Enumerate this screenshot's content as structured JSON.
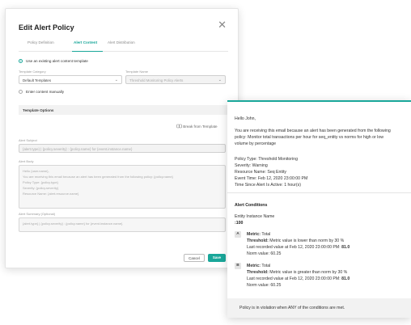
{
  "modal": {
    "title": "Edit Alert Policy",
    "close": "✕",
    "tabs": [
      {
        "label": "Policy Definition"
      },
      {
        "label": "Alert Content"
      },
      {
        "label": "Alert Distribution"
      }
    ],
    "option_existing": "Use an existing alert content template",
    "template_category_label": "Template Category",
    "template_category_value": "Default Templates",
    "template_name_label": "Template Name",
    "template_name_value": "Threshold Monitoring Policy Alerts",
    "option_manual": "Enter content manually",
    "template_options": "Template Options",
    "break_from_template": "Break from Template",
    "alert_subject_label": "Alert Subject",
    "alert_subject_value": "{alert.type} | {policy.severity} : {policy.name} for {event.instance.name}",
    "alert_body_label": "Alert Body",
    "alert_body_lines": [
      "Hello {user.name},",
      "",
      "You are receiving this email because an alert has been generated from the following policy: {policy.name}",
      "",
      "Policy Type: {policy.type}",
      "Severity: {policy.severity}",
      "Resource Name: {alert.resource.name}"
    ],
    "alert_summary_label": "Alert Summary (Optional)",
    "alert_summary_value": "{alert.type} | {policy.severity} : {policy.name} for {event.instance.name}",
    "cancel": "Cancel",
    "save": "Save"
  },
  "email": {
    "greeting": "Hello John,",
    "intro_lines": [
      "You are receiving this email because an alert has been generated from the following",
      "policy: Monitor total transactions per hour for seq_entity vs norms for high or low",
      "volume by percentage"
    ],
    "details": [
      "Policy Type: Threshold Monitoring",
      "Severity: Warning",
      "Resource Name: Seq Entity",
      "Event Time: Feb 12, 2020 23:00:00 PM",
      "Time Since Alert Is Active: 1 hour(s)"
    ],
    "conditions_title": "Alert Conditions",
    "entity_label": "Entity Instance Name",
    "entity_value": ":100",
    "conditions": [
      {
        "badge": "A",
        "metric_key": "Metric:",
        "metric_val": "Total",
        "threshold_key": "Threshold:",
        "threshold_val": "Metric value is lower than norm by 30 %",
        "last_text": "Last recorded value at Feb 12, 2020 23:00:00 PM:",
        "last_val": "81.0",
        "norm": "Norm value: 60.25"
      },
      {
        "badge": "B",
        "metric_key": "Metric:",
        "metric_val": "Total",
        "threshold_key": "Threshold:",
        "threshold_val": "Metric value is greater than norm by 30 %",
        "last_text": "Last recorded value at Feb 12, 2020 23:00:00 PM:",
        "last_val": "81.0",
        "norm": "Norm value: 60.25"
      }
    ],
    "footer": "Policy is in violation when ANY of the conditions are met."
  },
  "colors": {
    "accent": "#1aa79a"
  }
}
